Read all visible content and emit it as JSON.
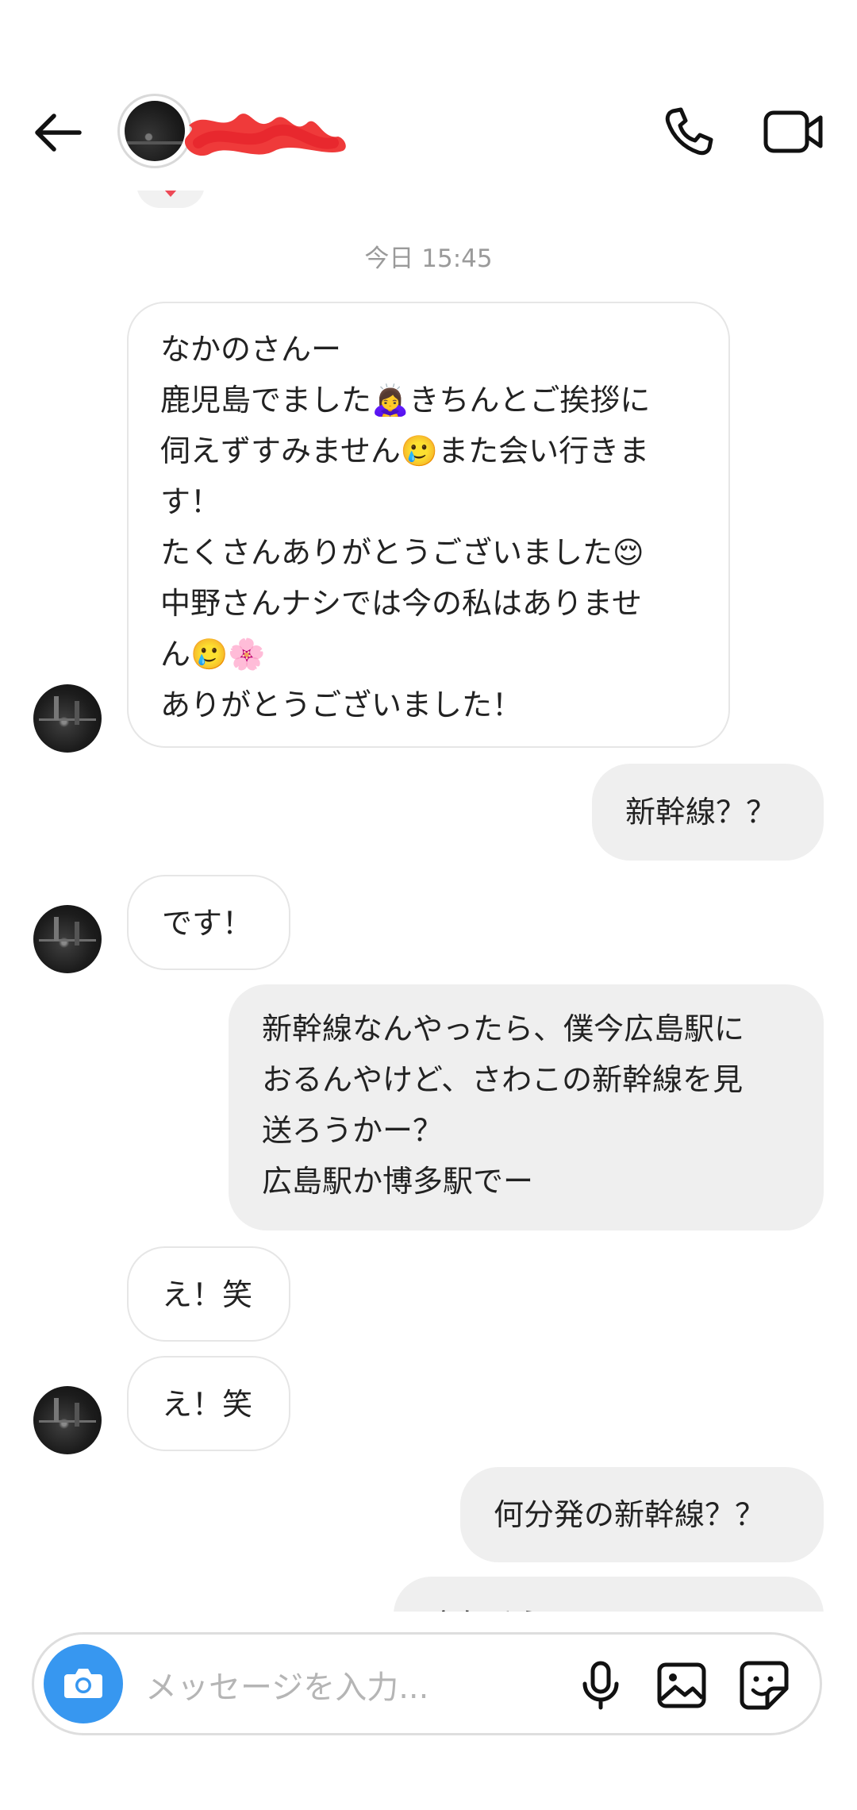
{
  "header": {
    "back_icon": "arrow-left-icon",
    "call_icon": "phone-icon",
    "video_icon": "video-camera-icon"
  },
  "thread": {
    "timestamp": "今日 15:45",
    "messages": [
      {
        "side": "in",
        "text": "なかのさんー\n鹿児島でました🙇‍♀️きちんとご挨拶に\n伺えずすみません🥲また会い行きま\nす！\nたくさんありがとうございました😌\n中野さんナシでは今の私はありませ\nん🥲🌸\nありがとうございました！"
      },
      {
        "side": "out",
        "text": "新幹線？？"
      },
      {
        "side": "in",
        "text": "です！"
      },
      {
        "side": "out",
        "text": "新幹線なんやったら、僕今広島駅に\nおるんやけど、さわこの新幹線を見\n送ろうかー？\n広島駅か博多駅でー"
      },
      {
        "side": "in",
        "text": "え！笑"
      },
      {
        "side": "in",
        "text": "え！笑"
      },
      {
        "side": "out",
        "text": "何分発の新幹線？？"
      },
      {
        "side": "out",
        "text": "さわそうろ"
      }
    ]
  },
  "composer": {
    "placeholder": "メッセージを入力...",
    "camera_icon": "camera-icon",
    "mic_icon": "microphone-icon",
    "gallery_icon": "gallery-icon",
    "sticker_icon": "sticker-icon",
    "accent": "#3797f0"
  }
}
